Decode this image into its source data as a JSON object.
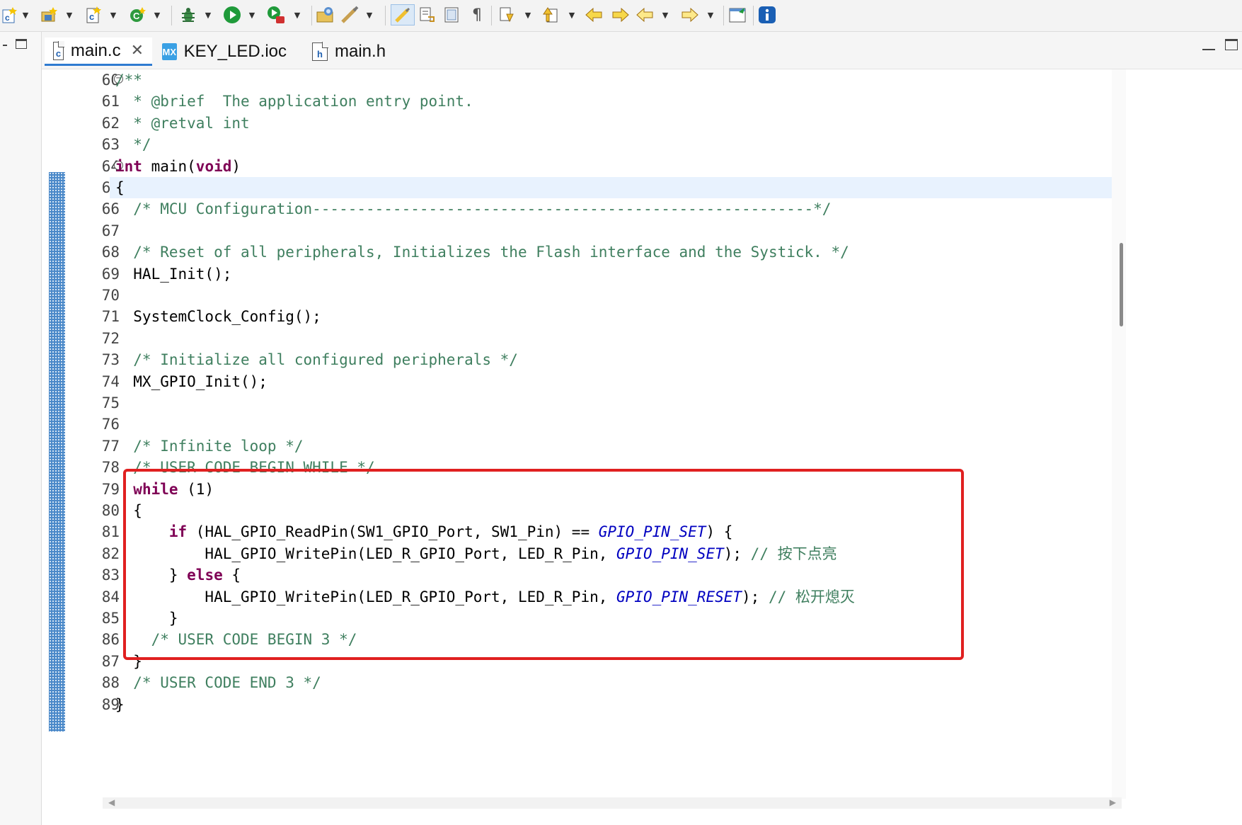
{
  "toolbar": {
    "icons": [
      "new-c-project-icon",
      "new-source-folder-icon",
      "new-c-class-icon",
      "new-configuration-icon",
      "debug-icon",
      "run-icon",
      "run-configuration-icon",
      "open-project-icon",
      "highlight-icon",
      "toggle-mark-icon",
      "toggle-block-icon",
      "show-whitespace-icon",
      "next-annotation-icon",
      "previous-annotation-icon",
      "last-edit-icon",
      "next-edit-icon",
      "back-icon",
      "forward-icon",
      "open-perspective-icon",
      "info-icon"
    ]
  },
  "tabs": [
    {
      "label": "main.c",
      "icon": "c-file-icon",
      "active": true,
      "closable": true
    },
    {
      "label": "KEY_LED.ioc",
      "icon": "mx-file-icon",
      "active": false,
      "closable": false
    },
    {
      "label": "main.h",
      "icon": "h-file-icon",
      "active": false,
      "closable": false
    }
  ],
  "editor": {
    "current_line": 65,
    "lines": [
      {
        "n": "60",
        "fold": "⊖",
        "segments": [
          {
            "t": "/**",
            "c": "cm"
          }
        ]
      },
      {
        "n": "61",
        "segments": [
          {
            "t": "  * @brief  The application entry point.",
            "c": "cm"
          }
        ]
      },
      {
        "n": "62",
        "segments": [
          {
            "t": "  * @retval int",
            "c": "cm"
          }
        ]
      },
      {
        "n": "63",
        "segments": [
          {
            "t": "  */",
            "c": "cm"
          }
        ]
      },
      {
        "n": "64",
        "fold": "⊖",
        "segments": [
          {
            "t": "int",
            "c": "kw"
          },
          {
            "t": " main(",
            "c": ""
          },
          {
            "t": "void",
            "c": "kw"
          },
          {
            "t": ")",
            "c": ""
          }
        ]
      },
      {
        "n": "65",
        "segments": [
          {
            "t": "{",
            "c": ""
          }
        ]
      },
      {
        "n": "66",
        "segments": [
          {
            "t": "  /* MCU Configuration--------------------------------------------------------*/",
            "c": "cm"
          }
        ]
      },
      {
        "n": "67",
        "segments": []
      },
      {
        "n": "68",
        "segments": [
          {
            "t": "  /* Reset of all peripherals, Initializes the Flash interface and the Systick. */",
            "c": "cm"
          }
        ]
      },
      {
        "n": "69",
        "segments": [
          {
            "t": "  HAL_Init();",
            "c": ""
          }
        ]
      },
      {
        "n": "70",
        "segments": []
      },
      {
        "n": "71",
        "segments": [
          {
            "t": "  SystemClock_Config();",
            "c": ""
          }
        ]
      },
      {
        "n": "72",
        "segments": []
      },
      {
        "n": "73",
        "segments": [
          {
            "t": "  /* Initialize all configured peripherals */",
            "c": "cm"
          }
        ]
      },
      {
        "n": "74",
        "segments": [
          {
            "t": "  MX_GPIO_Init();",
            "c": ""
          }
        ]
      },
      {
        "n": "75",
        "segments": []
      },
      {
        "n": "76",
        "segments": []
      },
      {
        "n": "77",
        "segments": [
          {
            "t": "  /* Infinite loop */",
            "c": "cm"
          }
        ]
      },
      {
        "n": "78",
        "segments": [
          {
            "t": "  /* USER CODE BEGIN WHILE */",
            "c": "cm"
          }
        ]
      },
      {
        "n": "79",
        "segments": [
          {
            "t": "  ",
            "c": ""
          },
          {
            "t": "while",
            "c": "kw"
          },
          {
            "t": " (1)",
            "c": ""
          }
        ]
      },
      {
        "n": "80",
        "segments": [
          {
            "t": "  {",
            "c": ""
          }
        ]
      },
      {
        "n": "81",
        "segments": [
          {
            "t": "      ",
            "c": ""
          },
          {
            "t": "if",
            "c": "kw"
          },
          {
            "t": " (HAL_GPIO_ReadPin(SW1_GPIO_Port, SW1_Pin) == ",
            "c": ""
          },
          {
            "t": "GPIO_PIN_SET",
            "c": "mac"
          },
          {
            "t": ") {",
            "c": ""
          }
        ]
      },
      {
        "n": "82",
        "segments": [
          {
            "t": "          HAL_GPIO_WritePin(LED_R_GPIO_Port, LED_R_Pin, ",
            "c": ""
          },
          {
            "t": "GPIO_PIN_SET",
            "c": "mac"
          },
          {
            "t": "); ",
            "c": ""
          },
          {
            "t": "// 按下点亮",
            "c": "cm"
          }
        ]
      },
      {
        "n": "83",
        "segments": [
          {
            "t": "      } ",
            "c": ""
          },
          {
            "t": "else",
            "c": "kw"
          },
          {
            "t": " {",
            "c": ""
          }
        ]
      },
      {
        "n": "84",
        "segments": [
          {
            "t": "          HAL_GPIO_WritePin(LED_R_GPIO_Port, LED_R_Pin, ",
            "c": ""
          },
          {
            "t": "GPIO_PIN_RESET",
            "c": "mac"
          },
          {
            "t": "); ",
            "c": ""
          },
          {
            "t": "// 松开熄灭",
            "c": "cm"
          }
        ]
      },
      {
        "n": "85",
        "segments": [
          {
            "t": "      }",
            "c": ""
          }
        ]
      },
      {
        "n": "86",
        "segments": [
          {
            "t": "    /* USER CODE BEGIN 3 */",
            "c": "cm"
          }
        ]
      },
      {
        "n": "87",
        "segments": [
          {
            "t": "  }",
            "c": ""
          }
        ]
      },
      {
        "n": "88",
        "segments": [
          {
            "t": "  /* USER CODE END 3 */",
            "c": "cm"
          }
        ]
      },
      {
        "n": "89",
        "segments": [
          {
            "t": "}",
            "c": ""
          }
        ]
      }
    ]
  },
  "colors": {
    "comment": "#3f7f5f",
    "keyword": "#7f0055",
    "macro": "#0000c0",
    "highlight_box": "#e02020",
    "current_line": "#e8f2fe",
    "tab_accent": "#2f7bd1"
  }
}
